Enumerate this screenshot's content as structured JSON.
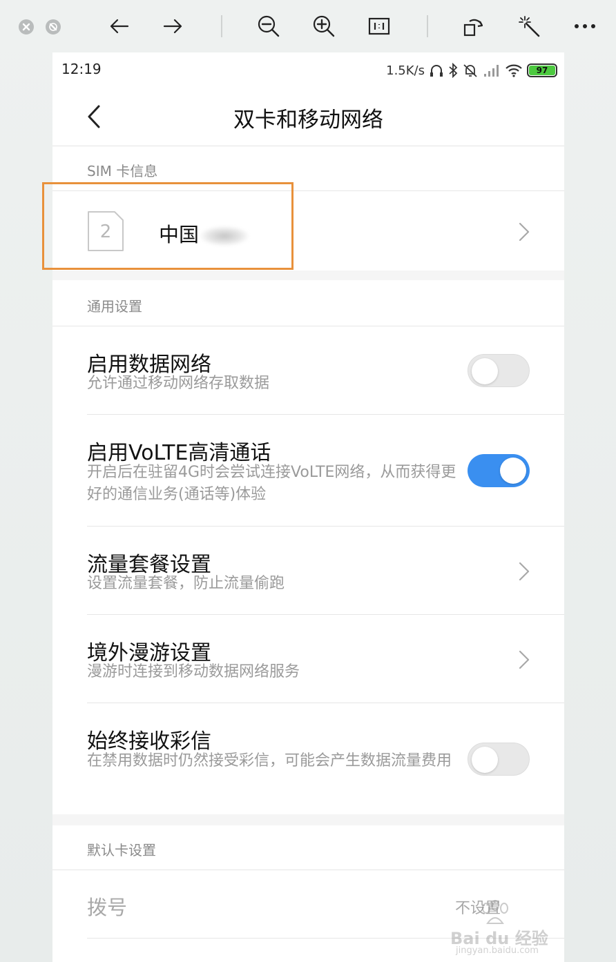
{
  "toolbar": {
    "buttons": [
      "close",
      "minimize",
      "back",
      "forward",
      "zoom-out",
      "zoom-in",
      "actual-size",
      "rotate",
      "magic",
      "more"
    ]
  },
  "status_bar": {
    "time": "12:19",
    "net_speed": "1.5K/s",
    "battery": "97"
  },
  "header": {
    "title": "双卡和移动网络"
  },
  "sim_section": {
    "header": "SIM 卡信息",
    "sim_slot": "2",
    "carrier": "中国"
  },
  "general_section": {
    "header": "通用设置",
    "items": [
      {
        "title": "启用数据网络",
        "subtitle": "允许通过移动网络存取数据",
        "control": "toggle",
        "state": "off"
      },
      {
        "title": "启用VoLTE高清通话",
        "subtitle": "开启后在驻留4G时会尝试连接VoLTE网络，从而获得更好的通信业务(通话等)体验",
        "control": "toggle",
        "state": "on"
      },
      {
        "title": "流量套餐设置",
        "subtitle": "设置流量套餐，防止流量偷跑",
        "control": "chevron"
      },
      {
        "title": "境外漫游设置",
        "subtitle": "漫游时连接到移动数据网络服务",
        "control": "chevron"
      },
      {
        "title": "始终接收彩信",
        "subtitle": "在禁用数据时仍然接受彩信，可能会产生数据流量费用",
        "control": "toggle",
        "state": "off"
      }
    ]
  },
  "default_section": {
    "header": "默认卡设置",
    "dial_label": "拨号",
    "dial_value": "不设置"
  },
  "watermark": {
    "brand": "Bai du 经验",
    "url": "jingyan.baidu.com"
  },
  "colors": {
    "accent": "#3a8ff0",
    "highlight": "#e8913b",
    "battery": "#4cc93f"
  }
}
